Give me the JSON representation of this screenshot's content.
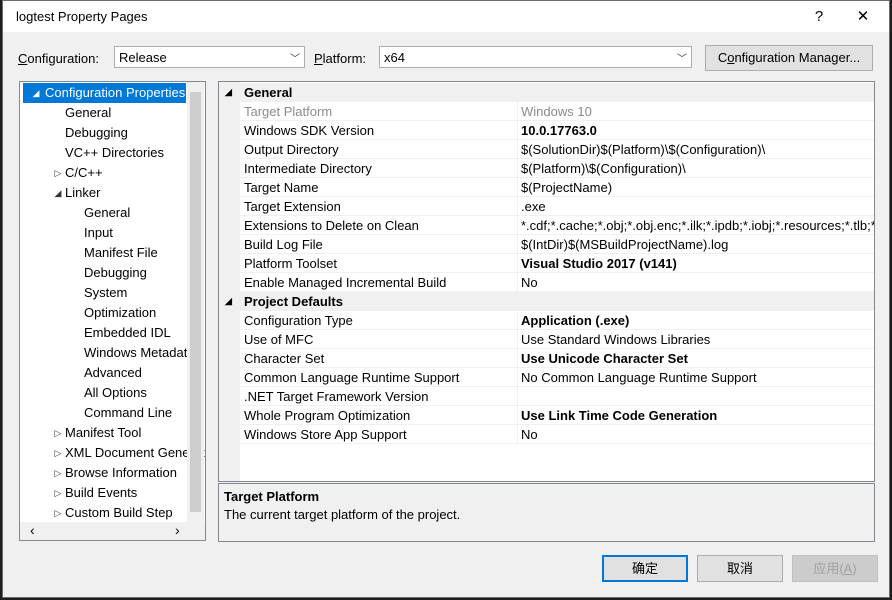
{
  "window": {
    "title": "logtest Property Pages",
    "help_glyph": "?",
    "close_glyph": "✕"
  },
  "toolbar": {
    "configuration_label_pre": "",
    "configuration_label_acc": "C",
    "configuration_label_post": "onfiguration:",
    "configuration_value": "Release",
    "platform_label_pre": "",
    "platform_label_acc": "P",
    "platform_label_post": "latform:",
    "platform_value": "x64",
    "config_manager_pre": "C",
    "config_manager_acc": "o",
    "config_manager_post": "nfiguration Manager..."
  },
  "tree": {
    "items": [
      {
        "label": "Configuration Properties",
        "expander": "◢"
      },
      {
        "label": "General"
      },
      {
        "label": "Debugging"
      },
      {
        "label": "VC++ Directories"
      },
      {
        "label": "C/C++",
        "expander": "▷"
      },
      {
        "label": "Linker",
        "expander": "◢"
      },
      {
        "label": "General"
      },
      {
        "label": "Input"
      },
      {
        "label": "Manifest File"
      },
      {
        "label": "Debugging"
      },
      {
        "label": "System"
      },
      {
        "label": "Optimization"
      },
      {
        "label": "Embedded IDL"
      },
      {
        "label": "Windows Metadata"
      },
      {
        "label": "Advanced"
      },
      {
        "label": "All Options"
      },
      {
        "label": "Command Line"
      },
      {
        "label": "Manifest Tool",
        "expander": "▷"
      },
      {
        "label": "XML Document Generator",
        "expander": "▷"
      },
      {
        "label": "Browse Information",
        "expander": "▷"
      },
      {
        "label": "Build Events",
        "expander": "▷"
      },
      {
        "label": "Custom Build Step",
        "expander": "▷"
      }
    ],
    "scroll_left": "‹",
    "scroll_right": "›"
  },
  "grid": {
    "general_category": "General",
    "general_rows": [
      {
        "name": "Target Platform",
        "value": "Windows 10",
        "disabled": true
      },
      {
        "name": "Windows SDK Version",
        "value": "10.0.17763.0",
        "bold": true
      },
      {
        "name": "Output Directory",
        "value": "$(SolutionDir)$(Platform)\\$(Configuration)\\"
      },
      {
        "name": "Intermediate Directory",
        "value": "$(Platform)\\$(Configuration)\\"
      },
      {
        "name": "Target Name",
        "value": "$(ProjectName)"
      },
      {
        "name": "Target Extension",
        "value": ".exe"
      },
      {
        "name": "Extensions to Delete on Clean",
        "value": "*.cdf;*.cache;*.obj;*.obj.enc;*.ilk;*.ipdb;*.iobj;*.resources;*.tlb;*.tli;*.t"
      },
      {
        "name": "Build Log File",
        "value": "$(IntDir)$(MSBuildProjectName).log"
      },
      {
        "name": "Platform Toolset",
        "value": "Visual Studio 2017 (v141)",
        "bold": true
      },
      {
        "name": "Enable Managed Incremental Build",
        "value": "No"
      }
    ],
    "defaults_category": "Project Defaults",
    "defaults_rows": [
      {
        "name": "Configuration Type",
        "value": "Application (.exe)",
        "bold": true
      },
      {
        "name": "Use of MFC",
        "value": "Use Standard Windows Libraries"
      },
      {
        "name": "Character Set",
        "value": "Use Unicode Character Set",
        "bold": true
      },
      {
        "name": "Common Language Runtime Support",
        "value": "No Common Language Runtime Support"
      },
      {
        "name": ".NET Target Framework Version",
        "value": ""
      },
      {
        "name": "Whole Program Optimization",
        "value": "Use Link Time Code Generation",
        "bold": true
      },
      {
        "name": "Windows Store App Support",
        "value": "No"
      }
    ]
  },
  "description": {
    "title": "Target Platform",
    "text": "The current target platform of the project."
  },
  "buttons": {
    "ok": "确定",
    "cancel": "取消",
    "apply_pre": "应用(",
    "apply_acc": "A",
    "apply_post": ")"
  },
  "colors": {
    "selection": "#0078d7",
    "window_bg": "#f0f0f0"
  }
}
